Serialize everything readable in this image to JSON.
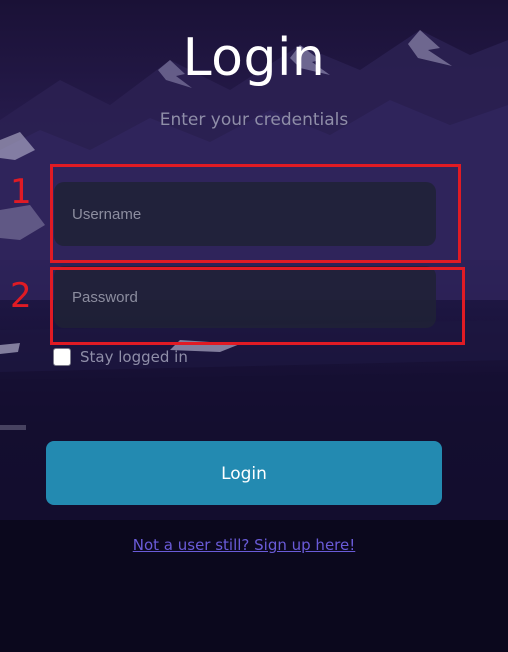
{
  "page": {
    "title": "Login",
    "subtitle": "Enter your credentials"
  },
  "form": {
    "username": {
      "value": "",
      "placeholder": "Username"
    },
    "password": {
      "value": "",
      "placeholder": "Password"
    },
    "remember": {
      "label": "Stay logged in",
      "checked": false
    },
    "submit_label": "Login",
    "signup_link": "Not a user still? Sign up here!"
  },
  "annotations": [
    {
      "label": "1",
      "target": "username"
    },
    {
      "label": "2",
      "target": "password"
    }
  ],
  "colors": {
    "accent": "#238ab1",
    "link": "#6a5bd8",
    "annotation": "#e01b24"
  }
}
